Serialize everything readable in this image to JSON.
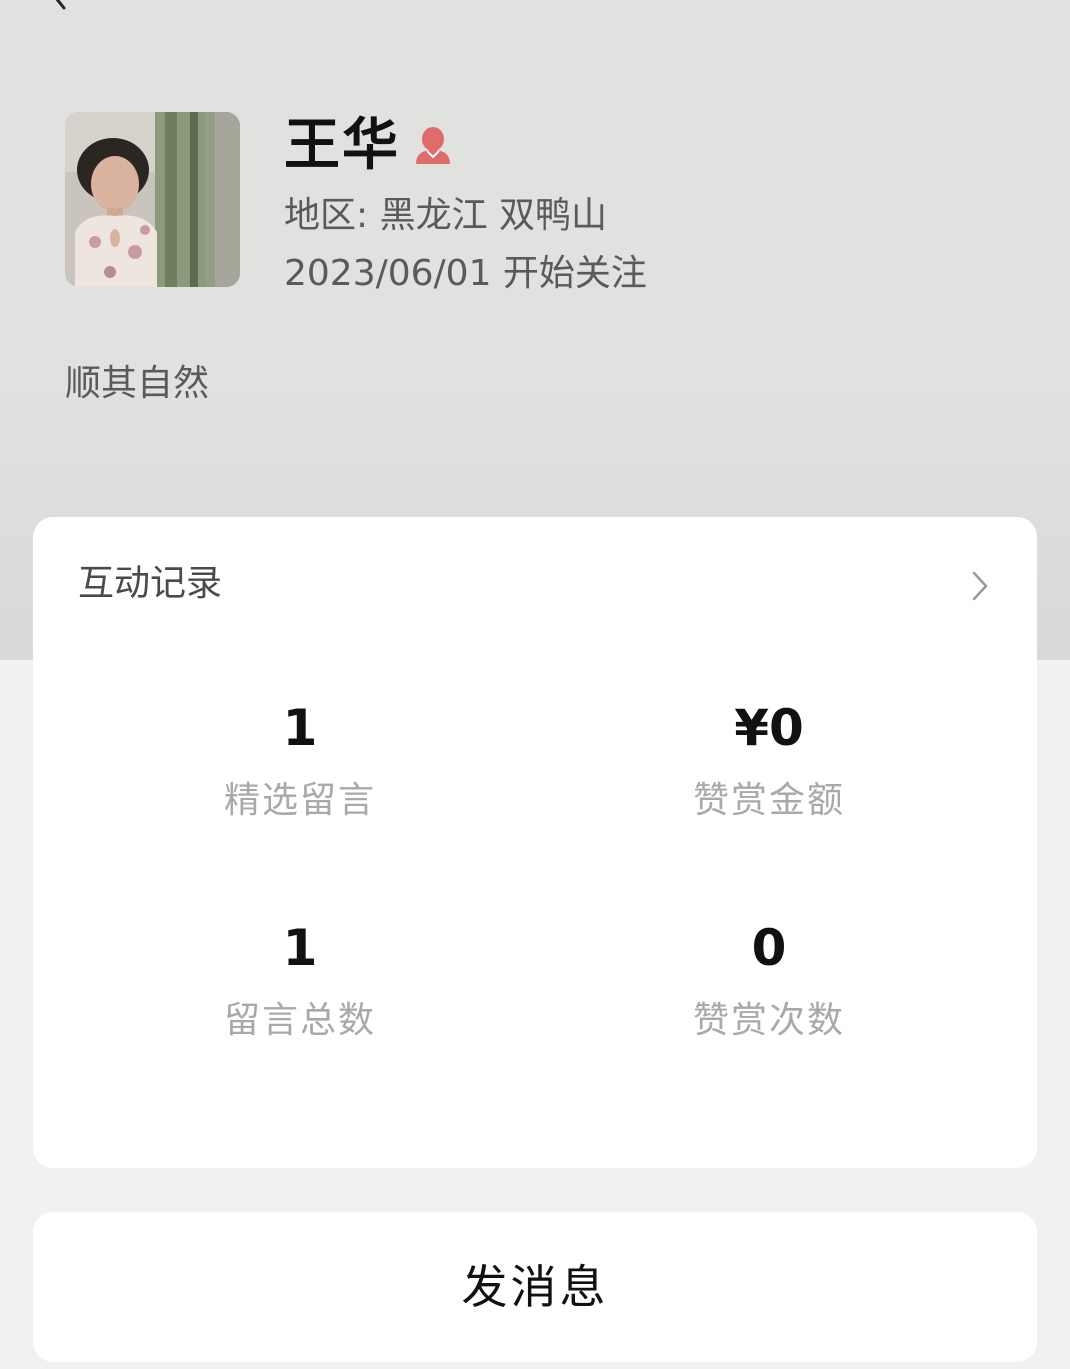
{
  "profile": {
    "name": "王华",
    "region": "地区: 黑龙江 双鸭山",
    "follow_date": "2023/06/01 开始关注",
    "signature": "顺其自然",
    "gender_icon": "female-user-icon",
    "gender_color": "#e06b6b"
  },
  "interaction": {
    "title": "互动记录",
    "stats": [
      {
        "value": "1",
        "label": "精选留言"
      },
      {
        "value": "¥0",
        "label": "赞赏金额"
      },
      {
        "value": "1",
        "label": "留言总数"
      },
      {
        "value": "0",
        "label": "赞赏次数"
      }
    ]
  },
  "actions": {
    "send_message": "发消息"
  },
  "icons": {
    "back": "back-arrow-icon",
    "chevron": "chevron-right-icon"
  },
  "colors": {
    "header_bg": "#e1e1df",
    "page_bg": "#f1f1f1",
    "card_bg": "#ffffff",
    "muted_text": "#a9a9a9"
  }
}
